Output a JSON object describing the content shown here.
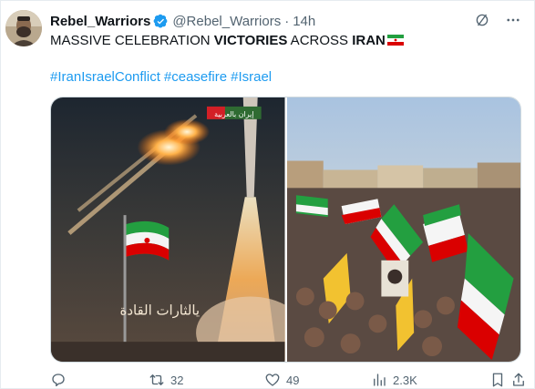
{
  "author": {
    "display_name": "Rebel_Warriors",
    "handle": "@Rebel_Warriors",
    "separator": "·",
    "time": "14h"
  },
  "tweet": {
    "text_part1": "MASSIVE CELEBRATION ",
    "text_bold1": "VICTORIES",
    "text_part2": " ACROSS ",
    "text_bold2": "IRAN",
    "hashtags": [
      "#IranIsraelConflict",
      "#ceasefire",
      "#Israel"
    ]
  },
  "media": {
    "left_image": {
      "badge_text": "إيران بالعربية",
      "calligraphy": "يالثارات القادة",
      "icon": "missile-flag-artwork"
    },
    "right_image": {
      "icon": "crowd-with-iranian-flags-photo"
    }
  },
  "actions": {
    "reply_count": "",
    "retweet_count": "32",
    "like_count": "49",
    "views_count": "2.3K"
  },
  "colors": {
    "link": "#1d9bf0",
    "muted": "#536471",
    "verified": "#1d9bf0"
  }
}
